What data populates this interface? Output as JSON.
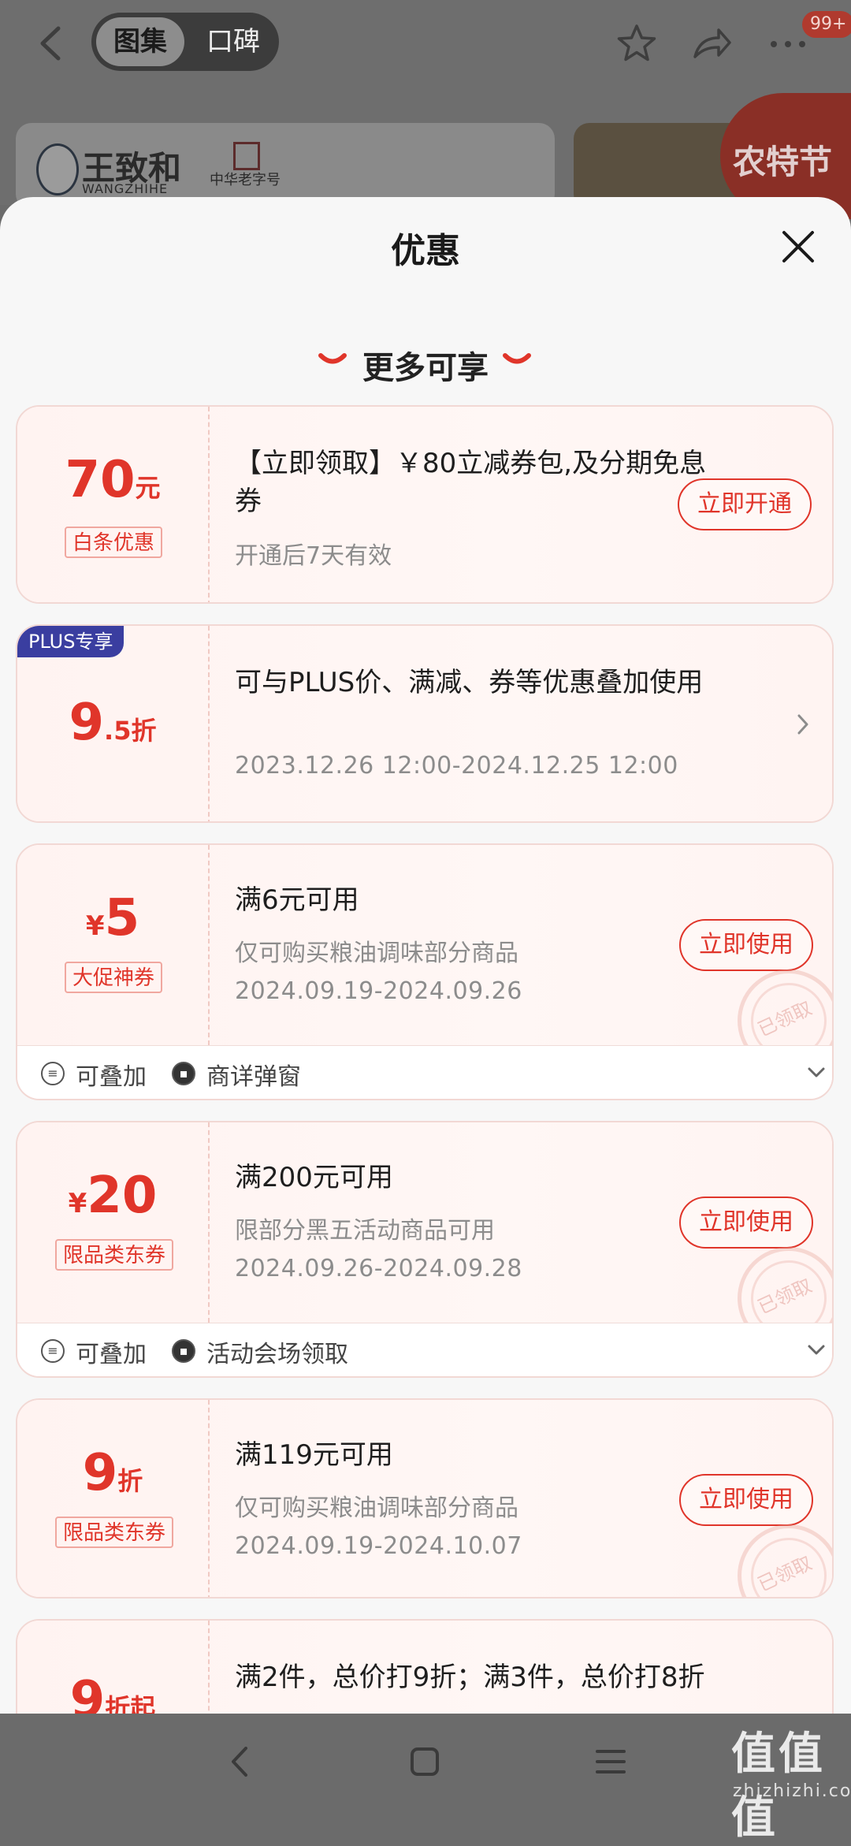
{
  "header": {
    "tabs": [
      {
        "label": "图集",
        "active": true
      },
      {
        "label": "口碑",
        "active": false
      }
    ],
    "message_badge": "99+",
    "icons": [
      "back-icon",
      "star-icon",
      "share-icon",
      "more-icon"
    ]
  },
  "background": {
    "brand_name": "王致和",
    "brand_name_en": "WANGZHIHE",
    "brand_tag": "中华老字号",
    "promo_label": "农特节"
  },
  "sheet": {
    "title": "优惠",
    "section_title": "更多可享"
  },
  "coupons": [
    {
      "amount": "70",
      "unit": "元",
      "tag": "白条优惠",
      "title": "【立即领取】￥80立减券包,及分期免息券",
      "subtitle": "开通后7天有效",
      "action": "立即开通"
    },
    {
      "badge": "PLUS专享",
      "amount": "9",
      "unit": ".5折",
      "title": "可与PLUS价、满减、券等优惠叠加使用",
      "date": "2023.12.26 12:00-2024.12.25 12:00"
    },
    {
      "currency": "¥",
      "amount": "5",
      "tag": "大促神券",
      "title": "满6元可用",
      "subtitle": "仅可购买粮油调味部分商品",
      "date": "2024.09.19-2024.09.26",
      "action": "立即使用",
      "stamp": "已领取",
      "footer": {
        "stack_label": "可叠加",
        "source_label": "商详弹窗"
      }
    },
    {
      "currency": "¥",
      "amount": "20",
      "tag": "限品类东券",
      "title": "满200元可用",
      "subtitle": "限部分黑五活动商品可用",
      "date": "2024.09.26-2024.09.28",
      "action": "立即使用",
      "stamp": "已领取",
      "footer": {
        "stack_label": "可叠加",
        "source_label": "活动会场领取"
      }
    },
    {
      "amount": "9",
      "unit": "折",
      "tag": "限品类东券",
      "title": "满119元可用",
      "subtitle": "仅可购买粮油调味部分商品",
      "date": "2024.09.19-2024.10.07",
      "action": "立即使用",
      "stamp": "已领取"
    },
    {
      "amount": "9",
      "unit": "折起",
      "title": "满2件，总价打9折；满3件，总价打8折"
    }
  ],
  "watermark": {
    "main": "值值值",
    "sub": "zhizhizhi.com"
  },
  "colors": {
    "accent": "#e0352a",
    "plus": "#3a3ea0",
    "sheet_bg": "#f7f7f7"
  }
}
